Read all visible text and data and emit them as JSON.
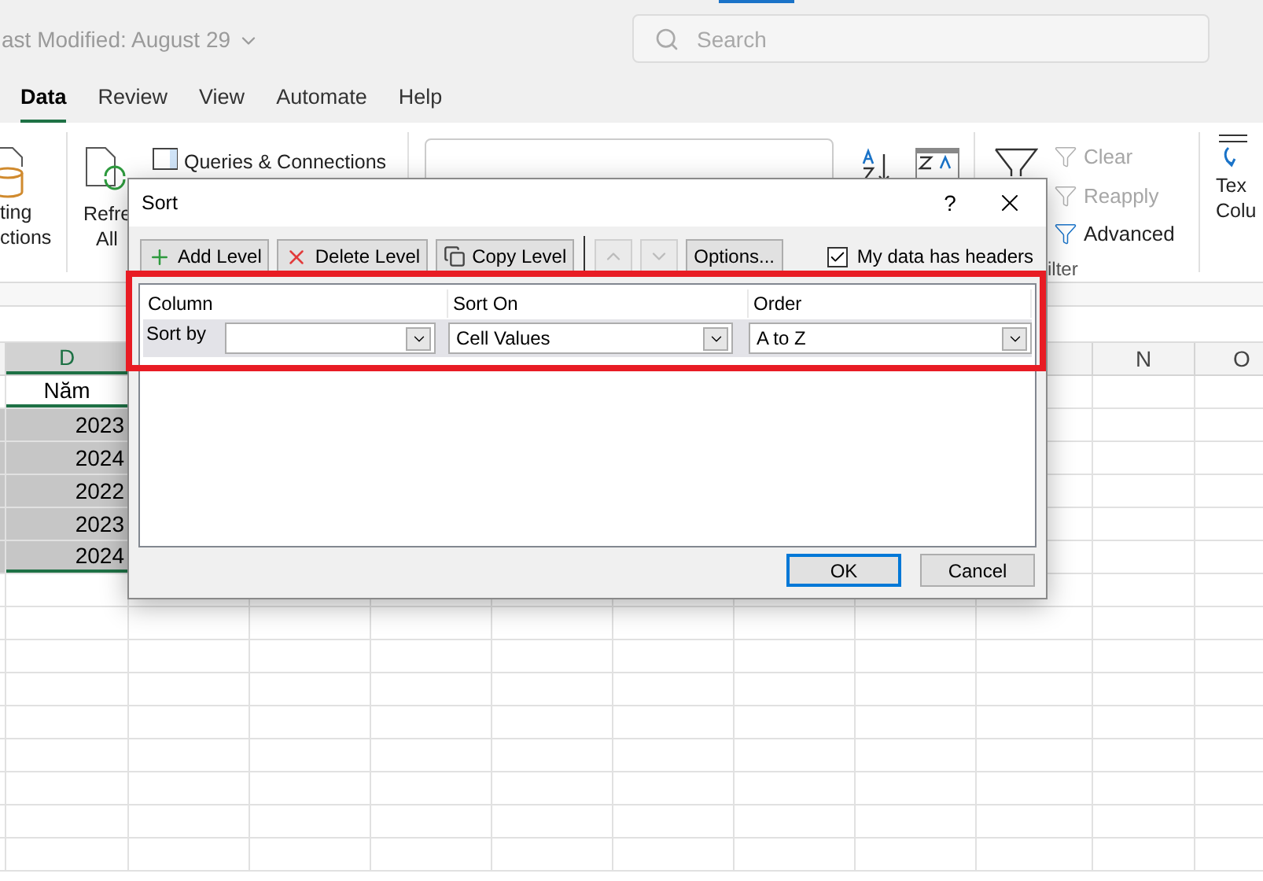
{
  "title_bar": {
    "document_status": "ast Modified: August 29",
    "search": {
      "placeholder": "Search"
    }
  },
  "ribbon_tabs": [
    {
      "label": "Data",
      "selected": true
    },
    {
      "label": "Review",
      "selected": false
    },
    {
      "label": "View",
      "selected": false
    },
    {
      "label": "Automate",
      "selected": false
    },
    {
      "label": "Help",
      "selected": false
    }
  ],
  "ribbon": {
    "existing_connections": [
      "ting",
      "ctions"
    ],
    "refresh_all": [
      "Refre",
      "All"
    ],
    "queries_connections": "Queries & Connections",
    "filter_commands": [
      {
        "label": "Clear",
        "disabled": true
      },
      {
        "label": "Reapply",
        "disabled": true
      },
      {
        "label": "Advanced",
        "disabled": false
      }
    ],
    "filter_group_label": "ilter",
    "text_to_columns": [
      "Tex",
      "Colu"
    ]
  },
  "sheet": {
    "column_headers": [
      {
        "label": "D",
        "selected": true
      },
      {
        "label": "N",
        "selected": false
      },
      {
        "label": "O",
        "selected": false
      }
    ],
    "column_d": {
      "header": "Năm",
      "values": [
        {
          "text": "2023",
          "selected": true
        },
        {
          "text": "2024",
          "selected": true
        },
        {
          "text": "2022",
          "selected": true
        },
        {
          "text": "2023",
          "selected": true
        },
        {
          "text": "2024",
          "selected": true
        }
      ]
    }
  },
  "sort_dialog": {
    "title": "Sort",
    "help": "?",
    "toolbar": [
      {
        "kind": "add",
        "label": "Add Level",
        "disabled": false
      },
      {
        "kind": "delete",
        "label": "Delete Level",
        "disabled": false
      },
      {
        "kind": "copy",
        "label": "Copy Level",
        "disabled": false
      },
      {
        "kind": "up",
        "disabled": true
      },
      {
        "kind": "down",
        "disabled": true
      },
      {
        "kind": "plain",
        "label": "Options...",
        "disabled": false
      }
    ],
    "headers_checkbox": {
      "label": "My data has headers",
      "checked": true
    },
    "columns": [
      "Column",
      "Sort On",
      "Order"
    ],
    "levels": [
      {
        "label": "Sort by",
        "sort_on": "Cell Values",
        "order": "A to Z",
        "selected": true
      }
    ],
    "buttons": [
      {
        "label": "OK",
        "default": true
      },
      {
        "label": "Cancel",
        "default": false
      }
    ]
  }
}
